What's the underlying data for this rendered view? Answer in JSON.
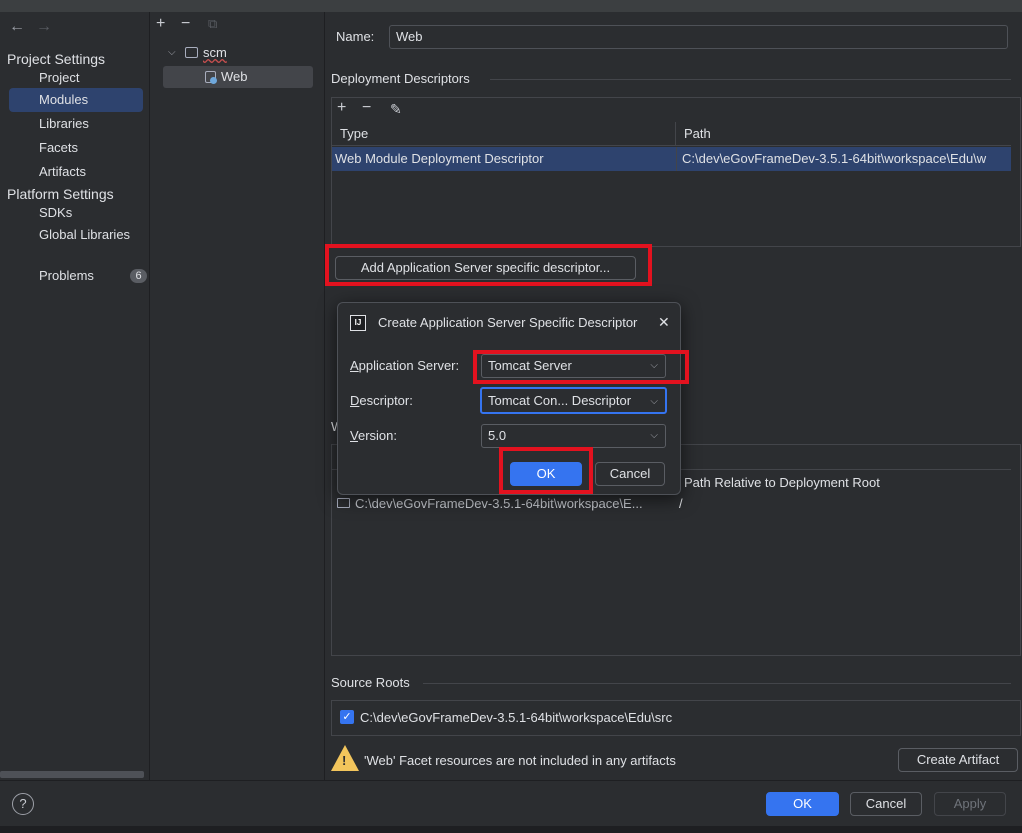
{
  "nav": {
    "back": "←",
    "forward": "→"
  },
  "sidebar": {
    "project_settings": "Project Settings",
    "items_project": [
      "Project",
      "Modules",
      "Libraries",
      "Facets",
      "Artifacts"
    ],
    "platform_settings": "Platform Settings",
    "items_platform": [
      "SDKs",
      "Global Libraries"
    ],
    "problems": "Problems",
    "problems_count": "6",
    "selected": "Modules"
  },
  "tree": {
    "toolbar": [
      "+",
      "−",
      "⧉"
    ],
    "root": "scm",
    "child": "Web"
  },
  "main": {
    "name_label": "Name:",
    "name_value": "Web",
    "deployment_title": "Deployment Descriptors",
    "dd_toolbar": [
      "+",
      "−",
      "✎"
    ],
    "col_type": "Type",
    "col_path": "Path",
    "row_type": "Web Module Deployment Descriptor",
    "row_path": "C:\\dev\\eGovFrameDev-3.5.1-64bit\\workspace\\Edu\\w",
    "add_server_button": "Add Application Server specific descriptor...",
    "web_resource_partial": "W",
    "col_path_rel": "Path Relative to Deployment Root",
    "web_dir_path": "C:\\dev\\eGovFrameDev-3.5.1-64bit\\workspace\\E...",
    "web_dir_rel": "/",
    "source_roots_title": "Source Roots",
    "source_root_path": "C:\\dev\\eGovFrameDev-3.5.1-64bit\\workspace\\Edu\\src",
    "warning_text": "'Web' Facet resources are not included in any artifacts",
    "create_artifact_button": "Create Artifact"
  },
  "dialog": {
    "title": "Create Application Server Specific Descriptor",
    "app_server_label": "Application Server:",
    "app_server_value": "Tomcat Server",
    "descriptor_label": "Descriptor:",
    "descriptor_value": "Tomcat Con... Descriptor",
    "version_label": "Version:",
    "version_value": "5.0",
    "ok": "OK",
    "cancel": "Cancel",
    "close": "✕",
    "app_icon": "IJ"
  },
  "footer": {
    "help": "?",
    "ok": "OK",
    "cancel": "Cancel",
    "apply": "Apply"
  },
  "colors": {
    "accent": "#3574f0",
    "selection": "#2e436e",
    "highlight": "#e3121f",
    "warning": "#f2c55c"
  }
}
